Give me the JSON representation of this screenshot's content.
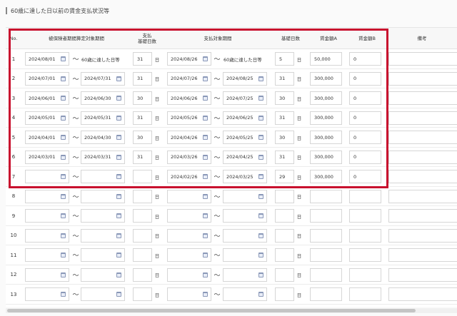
{
  "page": {
    "title": "60歳に達した日以前の賃金支払状況等"
  },
  "columns": {
    "no": "No.",
    "insured_period": "被保険者期間算定対象期間",
    "pay_base_days": "支払\n基礎日数",
    "pay_period": "支払対象期間",
    "base_days": "基礎日数",
    "amount_a": "賃金額A",
    "amount_b": "賃金額B",
    "remarks": "備考"
  },
  "unit_day": "日",
  "tilde": "～",
  "rows": [
    {
      "no": "1",
      "ins_from": "2024/08/01",
      "ins_to_text": "60歳に達した日等",
      "ins_to": "",
      "pay_days": "31",
      "pay_from": "2024/08/26",
      "pay_to_text": "60歳に達した日等",
      "pay_to": "",
      "base_days": "5",
      "amount_a": "50,000",
      "amount_b": "0"
    },
    {
      "no": "2",
      "ins_from": "2024/07/01",
      "ins_to_text": "",
      "ins_to": "2024/07/31",
      "pay_days": "31",
      "pay_from": "2024/07/26",
      "pay_to_text": "",
      "pay_to": "2024/08/25",
      "base_days": "31",
      "amount_a": "300,000",
      "amount_b": "0"
    },
    {
      "no": "3",
      "ins_from": "2024/06/01",
      "ins_to_text": "",
      "ins_to": "2024/06/30",
      "pay_days": "30",
      "pay_from": "2024/06/26",
      "pay_to_text": "",
      "pay_to": "2024/07/25",
      "base_days": "30",
      "amount_a": "300,000",
      "amount_b": "0"
    },
    {
      "no": "4",
      "ins_from": "2024/05/01",
      "ins_to_text": "",
      "ins_to": "2024/05/31",
      "pay_days": "31",
      "pay_from": "2024/05/26",
      "pay_to_text": "",
      "pay_to": "2024/06/25",
      "base_days": "31",
      "amount_a": "300,000",
      "amount_b": "0"
    },
    {
      "no": "5",
      "ins_from": "2024/04/01",
      "ins_to_text": "",
      "ins_to": "2024/04/30",
      "pay_days": "30",
      "pay_from": "2024/04/26",
      "pay_to_text": "",
      "pay_to": "2024/05/25",
      "base_days": "30",
      "amount_a": "300,000",
      "amount_b": "0"
    },
    {
      "no": "6",
      "ins_from": "2024/03/01",
      "ins_to_text": "",
      "ins_to": "2024/03/31",
      "pay_days": "31",
      "pay_from": "2024/03/26",
      "pay_to_text": "",
      "pay_to": "2024/04/25",
      "base_days": "31",
      "amount_a": "300,000",
      "amount_b": "0"
    },
    {
      "no": "7",
      "ins_from": "",
      "ins_to_text": "",
      "ins_to": "",
      "pay_days": "",
      "pay_from": "2024/02/26",
      "pay_to_text": "",
      "pay_to": "2024/03/25",
      "base_days": "29",
      "amount_a": "300,000",
      "amount_b": "0"
    },
    {
      "no": "8",
      "ins_from": "",
      "ins_to_text": "",
      "ins_to": "",
      "pay_days": "",
      "pay_from": "",
      "pay_to_text": "",
      "pay_to": "",
      "base_days": "",
      "amount_a": "",
      "amount_b": ""
    },
    {
      "no": "9",
      "ins_from": "",
      "ins_to_text": "",
      "ins_to": "",
      "pay_days": "",
      "pay_from": "",
      "pay_to_text": "",
      "pay_to": "",
      "base_days": "",
      "amount_a": "",
      "amount_b": ""
    },
    {
      "no": "10",
      "ins_from": "",
      "ins_to_text": "",
      "ins_to": "",
      "pay_days": "",
      "pay_from": "",
      "pay_to_text": "",
      "pay_to": "",
      "base_days": "",
      "amount_a": "",
      "amount_b": ""
    },
    {
      "no": "11",
      "ins_from": "",
      "ins_to_text": "",
      "ins_to": "",
      "pay_days": "",
      "pay_from": "",
      "pay_to_text": "",
      "pay_to": "",
      "base_days": "",
      "amount_a": "",
      "amount_b": ""
    },
    {
      "no": "12",
      "ins_from": "",
      "ins_to_text": "",
      "ins_to": "",
      "pay_days": "",
      "pay_from": "",
      "pay_to_text": "",
      "pay_to": "",
      "base_days": "",
      "amount_a": "",
      "amount_b": ""
    },
    {
      "no": "13",
      "ins_from": "",
      "ins_to_text": "",
      "ins_to": "",
      "pay_days": "",
      "pay_from": "",
      "pay_to_text": "",
      "pay_to": "",
      "base_days": "",
      "amount_a": "",
      "amount_b": ""
    }
  ],
  "icons": {
    "calendar": "calendar-icon"
  },
  "colors": {
    "highlight": "#c8102e"
  }
}
